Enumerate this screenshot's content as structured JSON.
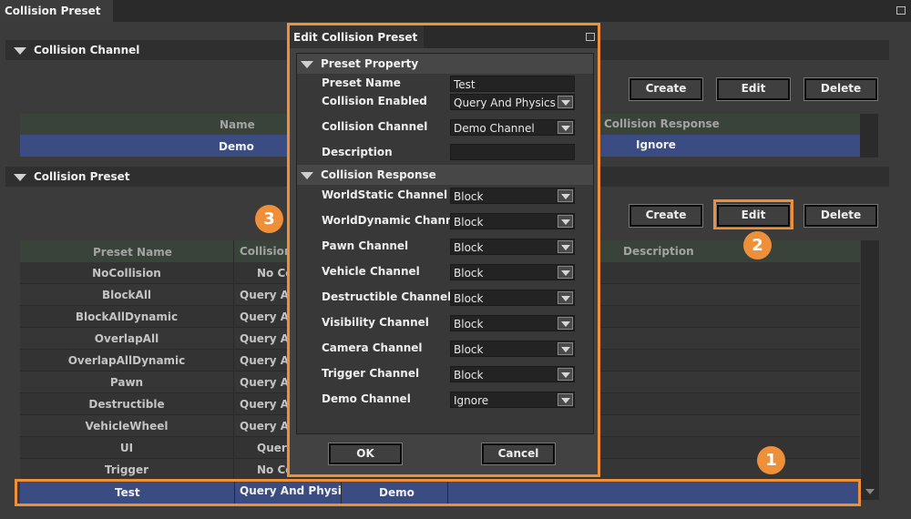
{
  "window": {
    "tab_title": "Collision Preset"
  },
  "channel_section": {
    "title": "Collision Channel",
    "buttons": {
      "create": "Create",
      "edit": "Edit",
      "delete": "Delete"
    },
    "headers": {
      "name": "Name",
      "response": "Collision Response"
    },
    "rows": [
      {
        "name": "Demo",
        "response": "Ignore"
      }
    ]
  },
  "preset_section": {
    "title": "Collision Preset",
    "buttons": {
      "create": "Create",
      "edit": "Edit",
      "delete": "Delete"
    },
    "headers": {
      "preset_name": "Preset Name",
      "collision": "Collision",
      "description": "Description"
    },
    "rows": [
      {
        "name": "NoCollision",
        "collision": "No Co"
      },
      {
        "name": "BlockAll",
        "collision": "Query An"
      },
      {
        "name": "BlockAllDynamic",
        "collision": "Query An"
      },
      {
        "name": "OverlapAll",
        "collision": "Query An"
      },
      {
        "name": "OverlapAllDynamic",
        "collision": "Query An"
      },
      {
        "name": "Pawn",
        "collision": "Query An"
      },
      {
        "name": "Destructible",
        "collision": "Query An"
      },
      {
        "name": "VehicleWheel",
        "collision": "Query An"
      },
      {
        "name": "UI",
        "collision": "Query"
      },
      {
        "name": "Trigger",
        "collision": "No Co"
      }
    ],
    "selected_row": {
      "name": "Test",
      "collision": "Query And Physics",
      "channel": "Demo"
    }
  },
  "dialog": {
    "title": "Edit Collision Preset",
    "property_section": "Preset Property",
    "preset_name_label": "Preset Name",
    "preset_name_value": "Test",
    "collision_enabled_label": "Collision Enabled",
    "collision_enabled_value": "Query And Physics",
    "collision_channel_label": "Collision Channel",
    "collision_channel_value": "Demo Channel",
    "description_label": "Description",
    "description_value": "",
    "response_section": "Collision Response",
    "responses": [
      {
        "label": "WorldStatic Channel",
        "value": "Block"
      },
      {
        "label": "WorldDynamic Channel",
        "value": "Block"
      },
      {
        "label": "Pawn Channel",
        "value": "Block"
      },
      {
        "label": "Vehicle Channel",
        "value": "Block"
      },
      {
        "label": "Destructible Channel",
        "value": "Block"
      },
      {
        "label": "Visibility Channel",
        "value": "Block"
      },
      {
        "label": "Camera Channel",
        "value": "Block"
      },
      {
        "label": "Trigger Channel",
        "value": "Block"
      },
      {
        "label": "Demo Channel",
        "value": "Ignore"
      }
    ],
    "ok": "OK",
    "cancel": "Cancel"
  },
  "badges": {
    "one": "1",
    "two": "2",
    "three": "3"
  },
  "colors": {
    "accent": "#ee8f3a",
    "selection": "#3a4c81",
    "header": "#394339"
  }
}
